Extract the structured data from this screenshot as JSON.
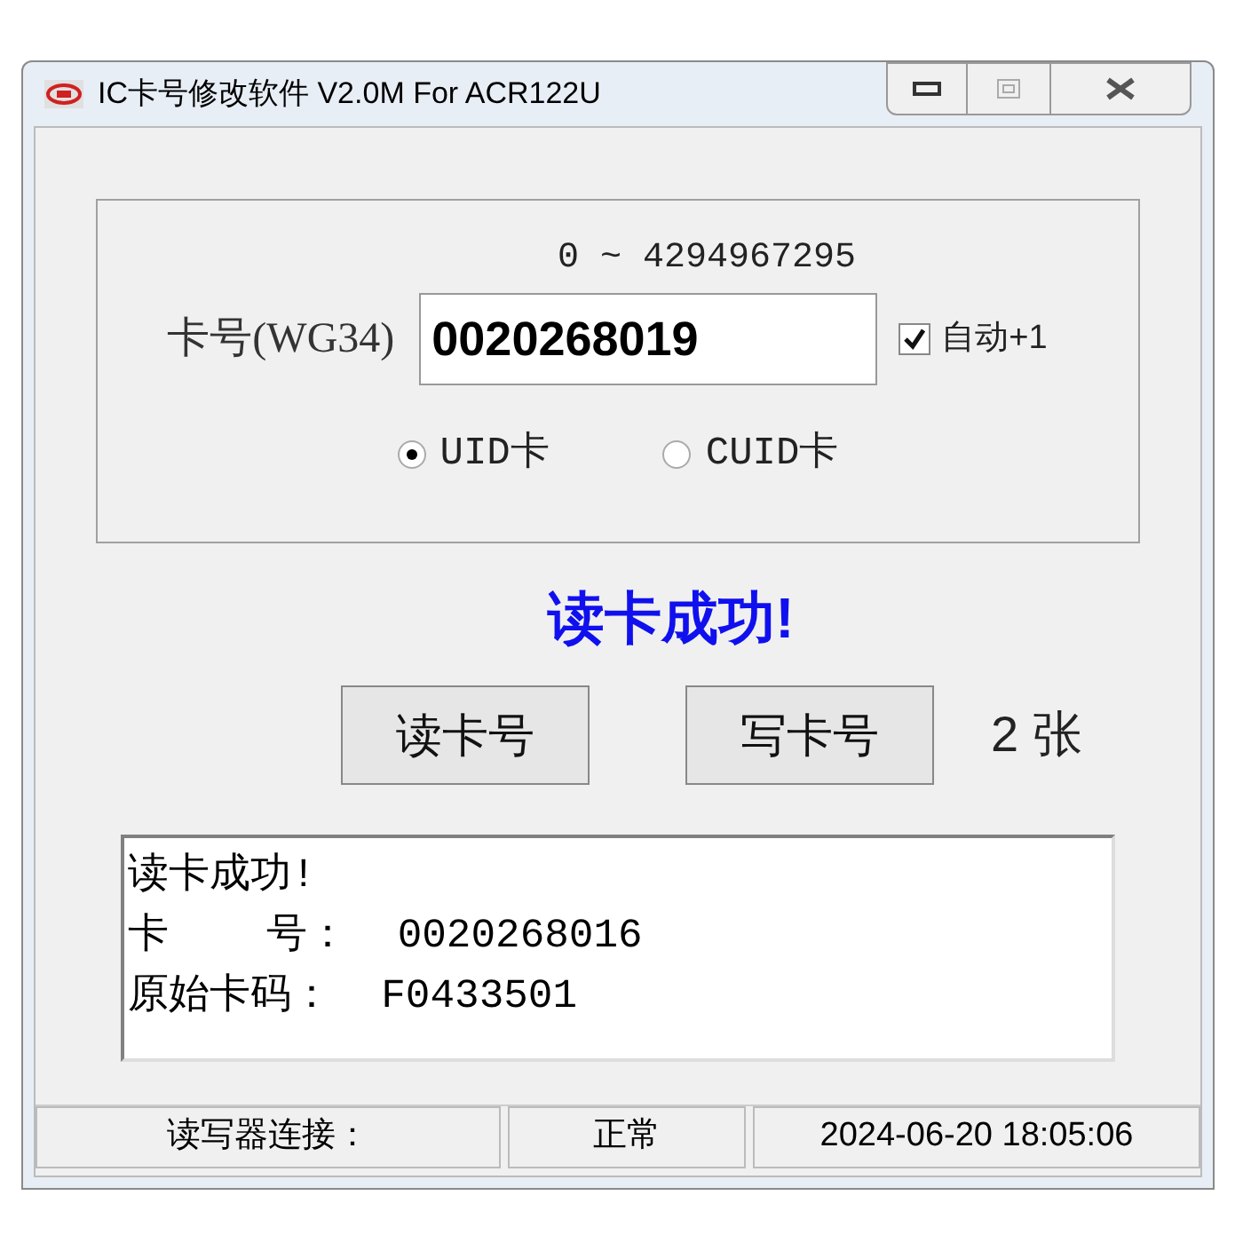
{
  "window": {
    "title": "IC卡号修改软件 V2.0M For ACR122U"
  },
  "range_label": "0 ~ 4294967295",
  "card_number": {
    "label": "卡号(WG34)",
    "value": "0020268019"
  },
  "auto_increment": {
    "label": "自动+1",
    "checked": true
  },
  "card_types": [
    {
      "label": "UID卡",
      "selected": true
    },
    {
      "label": "CUID卡",
      "selected": false
    }
  ],
  "result_message": "读卡成功!",
  "buttons": [
    {
      "label": "读卡号"
    },
    {
      "label": "写卡号"
    }
  ],
  "count": "2 张",
  "log_lines": [
    "读卡成功!",
    "卡    号：  0020268016",
    "原始卡码：  F0433501"
  ],
  "status_bar": [
    "读写器连接：",
    "正常",
    "2024-06-20 18:05:06"
  ]
}
